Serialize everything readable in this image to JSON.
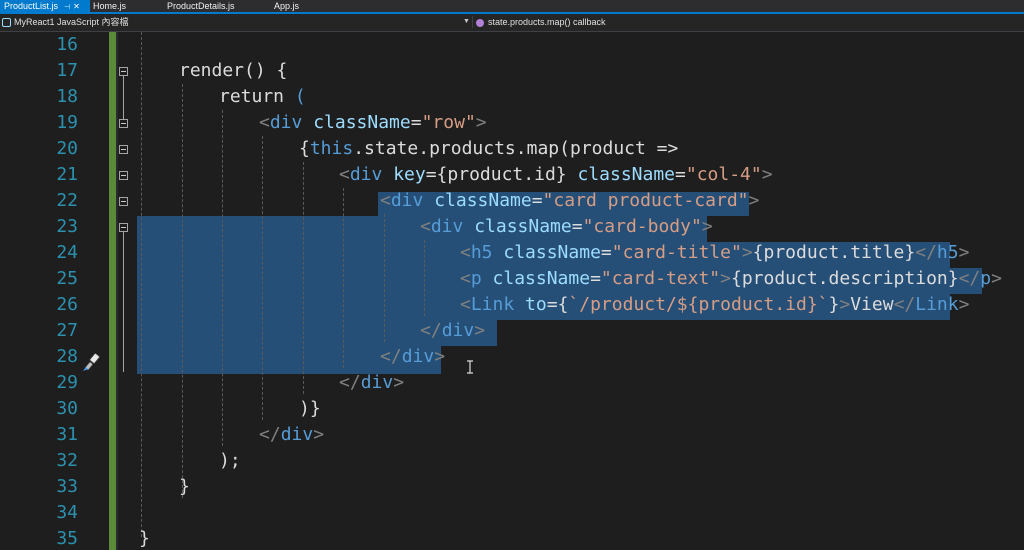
{
  "tabs": [
    {
      "label": "ProductList.js",
      "active": true
    },
    {
      "label": "Home.js",
      "active": false
    },
    {
      "label": "ProductDetails.js",
      "active": false
    },
    {
      "label": "App.js",
      "active": false
    }
  ],
  "navbar": {
    "project": "MyReact1 JavaScript 內容檔",
    "member": "state.products.map() callback"
  },
  "colors": {
    "accent": "#007acc",
    "selection": "#264f78",
    "line_number": "#2b91af",
    "change_bar": "#5a8a3a",
    "keyword": "#569cd6",
    "attribute": "#9cdcfe",
    "string": "#d69d85"
  },
  "icons": {
    "quick_action": "paintbrush-icon",
    "cursor": "ibeam-cursor-icon",
    "tab_pin": "pin-icon",
    "tab_close": "close-icon",
    "dropdown": "chevron-down-icon"
  },
  "editor": {
    "line_numbers": [
      "16",
      "17",
      "18",
      "19",
      "20",
      "21",
      "22",
      "23",
      "24",
      "25",
      "26",
      "27",
      "28",
      "29",
      "30",
      "31",
      "32",
      "33",
      "34",
      "35"
    ],
    "lines": [
      {
        "number": "16",
        "text": ""
      },
      {
        "number": "17",
        "text": "render() {"
      },
      {
        "number": "18",
        "text": "return ("
      },
      {
        "number": "19",
        "text": "<div className=\"row\">"
      },
      {
        "number": "20",
        "text": "{this.state.products.map(product =>"
      },
      {
        "number": "21",
        "text": "<div key={product.id} className=\"col-4\">"
      },
      {
        "number": "22",
        "text": "<div className=\"card product-card\">"
      },
      {
        "number": "23",
        "text": "<div className=\"card-body\">"
      },
      {
        "number": "24",
        "text": "<h5 className=\"card-title\">{product.title}</h5>"
      },
      {
        "number": "25",
        "text": "<p className=\"card-text\">{product.description}</p>"
      },
      {
        "number": "26",
        "text": "<Link to={`/product/${product.id}`}>View</Link>"
      },
      {
        "number": "27",
        "text": "</div>"
      },
      {
        "number": "28",
        "text": "</div>"
      },
      {
        "number": "29",
        "text": "</div>"
      },
      {
        "number": "30",
        "text": ")}"
      },
      {
        "number": "31",
        "text": "</div>"
      },
      {
        "number": "32",
        "text": ");"
      },
      {
        "number": "33",
        "text": "}"
      },
      {
        "number": "34",
        "text": ""
      },
      {
        "number": "35",
        "text": "}"
      }
    ]
  }
}
